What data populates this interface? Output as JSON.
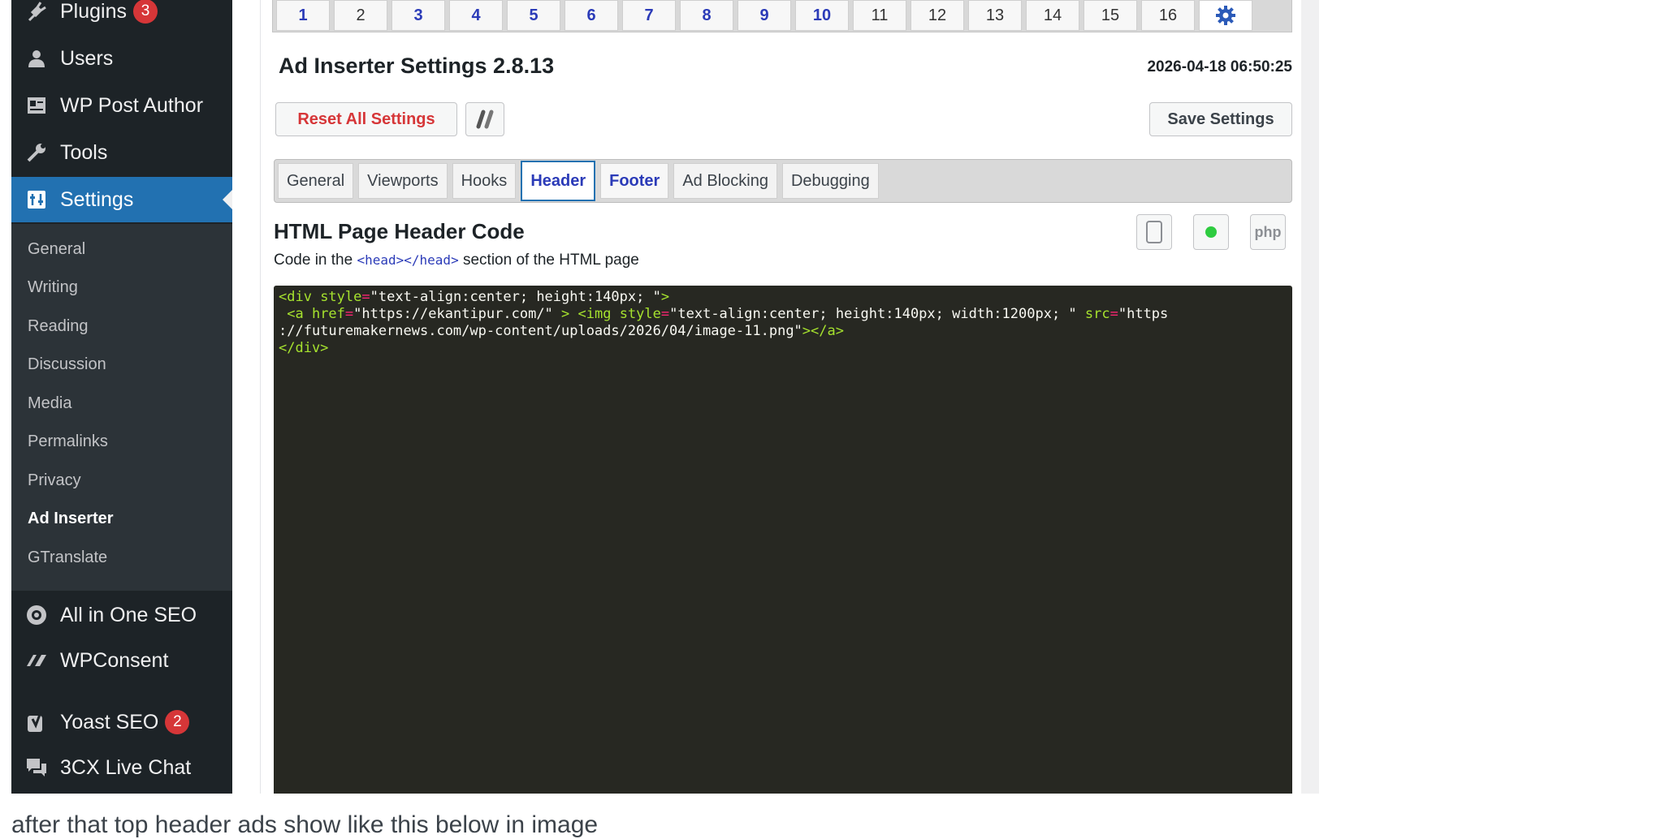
{
  "sidebar": {
    "items": [
      {
        "label": "Plugins",
        "badge": "3",
        "icon": "plugin-icon"
      },
      {
        "label": "Users",
        "icon": "users-icon"
      },
      {
        "label": "WP Post Author",
        "icon": "id-card-icon"
      },
      {
        "label": "Tools",
        "icon": "wrench-icon"
      },
      {
        "label": "Settings",
        "icon": "settings-icon",
        "active": true
      },
      {
        "label": "All in One SEO",
        "icon": "aioseo-icon"
      },
      {
        "label": "WPConsent",
        "icon": "wpconsent-icon"
      },
      {
        "label": "Yoast SEO",
        "badge": "2",
        "icon": "yoast-icon"
      },
      {
        "label": "3CX Live Chat",
        "icon": "chat-icon"
      }
    ],
    "submenu": [
      "General",
      "Writing",
      "Reading",
      "Discussion",
      "Media",
      "Permalinks",
      "Privacy",
      "Ad Inserter",
      "GTranslate"
    ],
    "submenu_current": "Ad Inserter"
  },
  "block_tabs": [
    "1",
    "2",
    "3",
    "4",
    "5",
    "6",
    "7",
    "8",
    "9",
    "10",
    "11",
    "12",
    "13",
    "14",
    "15",
    "16"
  ],
  "header": {
    "title": "Ad Inserter Settings 2.8.13",
    "datetime": "2026-04-18 06:50:25",
    "reset_label": "Reset All Settings",
    "save_label": "Save Settings"
  },
  "settings_tabs": [
    "General",
    "Viewports",
    "Hooks",
    "Header",
    "Footer",
    "Ad Blocking",
    "Debugging"
  ],
  "active_settings_tab": "Header",
  "section": {
    "heading": "HTML Page Header Code",
    "desc_prefix": "Code in the ",
    "desc_code": "<head></head>",
    "desc_suffix": " section of the HTML page",
    "php_label": "php"
  },
  "code": {
    "line1_tag": "<div",
    "line1_attr": " style",
    "line1_val": "\"text-align:center; height:140px; \"",
    "line1_end": ">",
    "line2_tag": " <a",
    "line2_attr": " href",
    "line2_val": "\"https://ekantipur.com/\"",
    "line2_mid": " > ",
    "line2_tag2": "<img",
    "line2_attr2": " style",
    "line2_val2": "\"text-align:center; height:140px; width:1200px; \"",
    "line2_attr3": " src",
    "line2_val3": "\"https",
    "line3_val": "://futuremakernews.com/wp-content/uploads/2026/04/image-11.png\"",
    "line3_end": "></a>",
    "line4": "</div>"
  },
  "bottom_text": "after that top header ads show like this below in image",
  "colors": {
    "sidebar_bg": "#1d2327",
    "active_blue": "#2271b1",
    "badge_red": "#d63638",
    "editor_bg": "#272822",
    "status_green": "#2ecc40"
  }
}
